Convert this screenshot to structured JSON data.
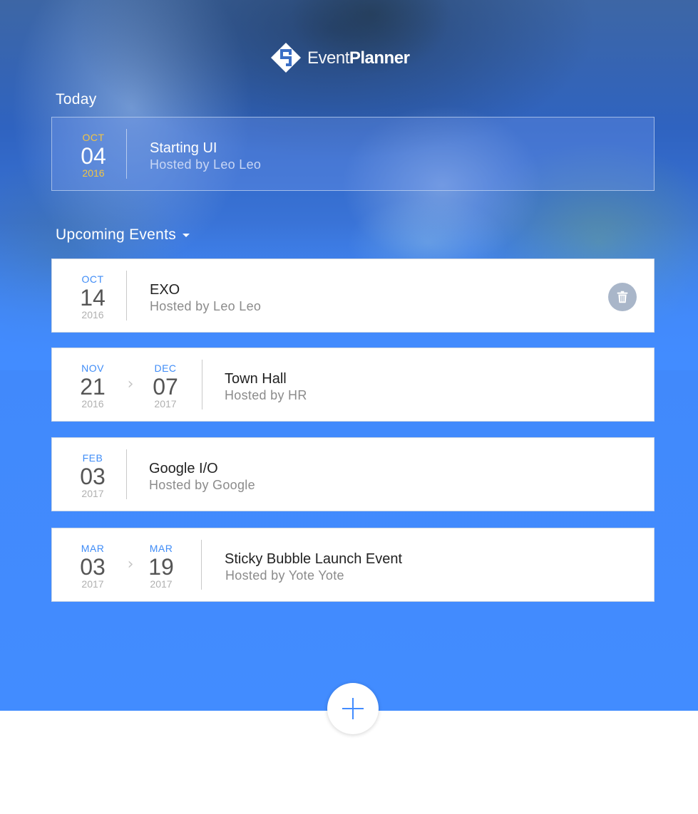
{
  "app": {
    "logo_light": "Event",
    "logo_bold": "Planner"
  },
  "today": {
    "heading": "Today",
    "event": {
      "month": "OCT",
      "day": "04",
      "year": "2016",
      "title": "Starting UI",
      "host": "Hosted by Leo Leo"
    }
  },
  "upcoming": {
    "heading": "Upcoming Events",
    "events": [
      {
        "start": {
          "month": "OCT",
          "day": "14",
          "year": "2016"
        },
        "title": "EXO",
        "host": "Hosted by Leo Leo"
      },
      {
        "start": {
          "month": "NOV",
          "day": "21",
          "year": "2016"
        },
        "end": {
          "month": "DEC",
          "day": "07",
          "year": "2017"
        },
        "title": "Town Hall",
        "host": "Hosted by HR"
      },
      {
        "start": {
          "month": "FEB",
          "day": "03",
          "year": "2017"
        },
        "title": "Google I/O",
        "host": "Hosted by Google"
      },
      {
        "start": {
          "month": "MAR",
          "day": "03",
          "year": "2017"
        },
        "end": {
          "month": "MAR",
          "day": "19",
          "year": "2017"
        },
        "title": "Sticky Bubble Launch Event",
        "host": "Hosted by Yote Yote"
      }
    ]
  },
  "icons": {
    "logo": "event-planner-logo-icon",
    "dropdown": "caret-down-icon",
    "range_arrow": "chevron-right-icon",
    "delete": "trash-icon",
    "add": "plus-icon"
  },
  "colors": {
    "accent": "#428cff",
    "today_date": "#f3c542",
    "trash_bg": "#a9b6c9"
  }
}
